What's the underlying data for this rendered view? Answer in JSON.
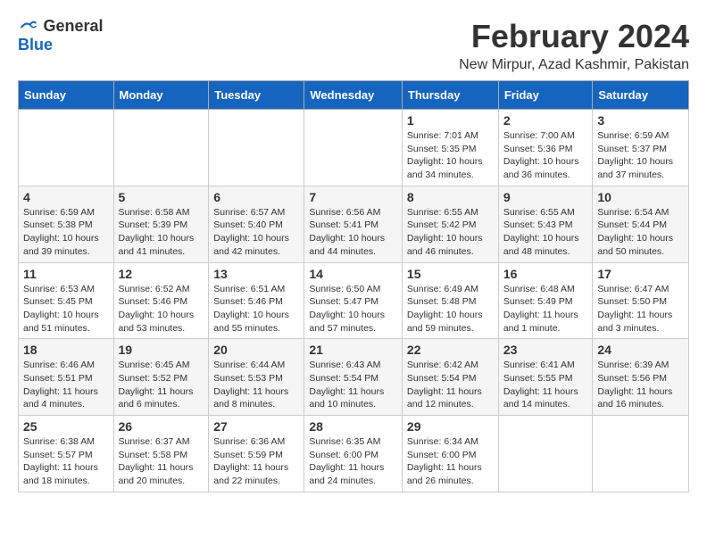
{
  "logo": {
    "general": "General",
    "blue": "Blue"
  },
  "header": {
    "month_title": "February 2024",
    "location": "New Mirpur, Azad Kashmir, Pakistan"
  },
  "weekdays": [
    "Sunday",
    "Monday",
    "Tuesday",
    "Wednesday",
    "Thursday",
    "Friday",
    "Saturday"
  ],
  "weeks": [
    [
      {
        "day": "",
        "info": ""
      },
      {
        "day": "",
        "info": ""
      },
      {
        "day": "",
        "info": ""
      },
      {
        "day": "",
        "info": ""
      },
      {
        "day": "1",
        "info": "Sunrise: 7:01 AM\nSunset: 5:35 PM\nDaylight: 10 hours\nand 34 minutes."
      },
      {
        "day": "2",
        "info": "Sunrise: 7:00 AM\nSunset: 5:36 PM\nDaylight: 10 hours\nand 36 minutes."
      },
      {
        "day": "3",
        "info": "Sunrise: 6:59 AM\nSunset: 5:37 PM\nDaylight: 10 hours\nand 37 minutes."
      }
    ],
    [
      {
        "day": "4",
        "info": "Sunrise: 6:59 AM\nSunset: 5:38 PM\nDaylight: 10 hours\nand 39 minutes."
      },
      {
        "day": "5",
        "info": "Sunrise: 6:58 AM\nSunset: 5:39 PM\nDaylight: 10 hours\nand 41 minutes."
      },
      {
        "day": "6",
        "info": "Sunrise: 6:57 AM\nSunset: 5:40 PM\nDaylight: 10 hours\nand 42 minutes."
      },
      {
        "day": "7",
        "info": "Sunrise: 6:56 AM\nSunset: 5:41 PM\nDaylight: 10 hours\nand 44 minutes."
      },
      {
        "day": "8",
        "info": "Sunrise: 6:55 AM\nSunset: 5:42 PM\nDaylight: 10 hours\nand 46 minutes."
      },
      {
        "day": "9",
        "info": "Sunrise: 6:55 AM\nSunset: 5:43 PM\nDaylight: 10 hours\nand 48 minutes."
      },
      {
        "day": "10",
        "info": "Sunrise: 6:54 AM\nSunset: 5:44 PM\nDaylight: 10 hours\nand 50 minutes."
      }
    ],
    [
      {
        "day": "11",
        "info": "Sunrise: 6:53 AM\nSunset: 5:45 PM\nDaylight: 10 hours\nand 51 minutes."
      },
      {
        "day": "12",
        "info": "Sunrise: 6:52 AM\nSunset: 5:46 PM\nDaylight: 10 hours\nand 53 minutes."
      },
      {
        "day": "13",
        "info": "Sunrise: 6:51 AM\nSunset: 5:46 PM\nDaylight: 10 hours\nand 55 minutes."
      },
      {
        "day": "14",
        "info": "Sunrise: 6:50 AM\nSunset: 5:47 PM\nDaylight: 10 hours\nand 57 minutes."
      },
      {
        "day": "15",
        "info": "Sunrise: 6:49 AM\nSunset: 5:48 PM\nDaylight: 10 hours\nand 59 minutes."
      },
      {
        "day": "16",
        "info": "Sunrise: 6:48 AM\nSunset: 5:49 PM\nDaylight: 11 hours\nand 1 minute."
      },
      {
        "day": "17",
        "info": "Sunrise: 6:47 AM\nSunset: 5:50 PM\nDaylight: 11 hours\nand 3 minutes."
      }
    ],
    [
      {
        "day": "18",
        "info": "Sunrise: 6:46 AM\nSunset: 5:51 PM\nDaylight: 11 hours\nand 4 minutes."
      },
      {
        "day": "19",
        "info": "Sunrise: 6:45 AM\nSunset: 5:52 PM\nDaylight: 11 hours\nand 6 minutes."
      },
      {
        "day": "20",
        "info": "Sunrise: 6:44 AM\nSunset: 5:53 PM\nDaylight: 11 hours\nand 8 minutes."
      },
      {
        "day": "21",
        "info": "Sunrise: 6:43 AM\nSunset: 5:54 PM\nDaylight: 11 hours\nand 10 minutes."
      },
      {
        "day": "22",
        "info": "Sunrise: 6:42 AM\nSunset: 5:54 PM\nDaylight: 11 hours\nand 12 minutes."
      },
      {
        "day": "23",
        "info": "Sunrise: 6:41 AM\nSunset: 5:55 PM\nDaylight: 11 hours\nand 14 minutes."
      },
      {
        "day": "24",
        "info": "Sunrise: 6:39 AM\nSunset: 5:56 PM\nDaylight: 11 hours\nand 16 minutes."
      }
    ],
    [
      {
        "day": "25",
        "info": "Sunrise: 6:38 AM\nSunset: 5:57 PM\nDaylight: 11 hours\nand 18 minutes."
      },
      {
        "day": "26",
        "info": "Sunrise: 6:37 AM\nSunset: 5:58 PM\nDaylight: 11 hours\nand 20 minutes."
      },
      {
        "day": "27",
        "info": "Sunrise: 6:36 AM\nSunset: 5:59 PM\nDaylight: 11 hours\nand 22 minutes."
      },
      {
        "day": "28",
        "info": "Sunrise: 6:35 AM\nSunset: 6:00 PM\nDaylight: 11 hours\nand 24 minutes."
      },
      {
        "day": "29",
        "info": "Sunrise: 6:34 AM\nSunset: 6:00 PM\nDaylight: 11 hours\nand 26 minutes."
      },
      {
        "day": "",
        "info": ""
      },
      {
        "day": "",
        "info": ""
      }
    ]
  ]
}
